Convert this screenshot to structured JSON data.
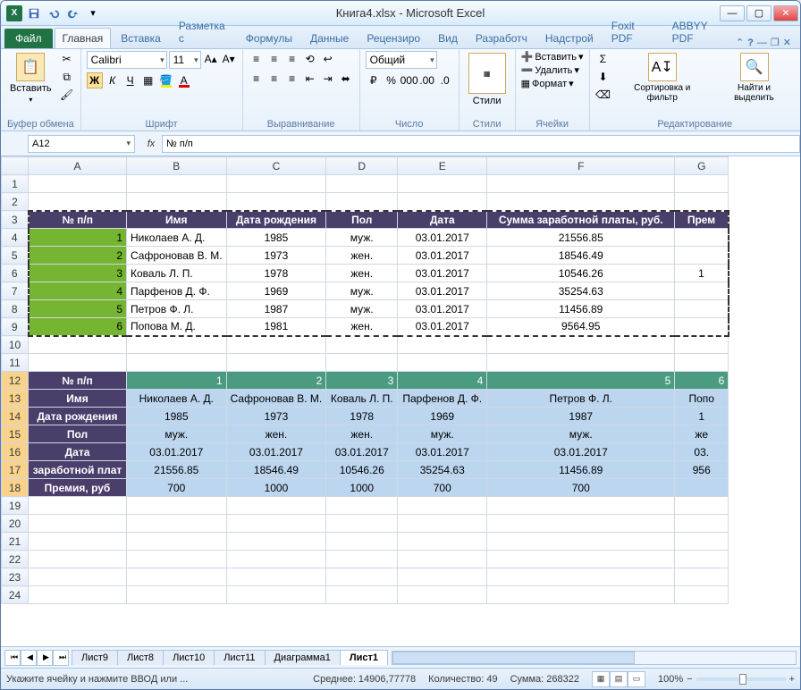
{
  "title": "Книга4.xlsx - Microsoft Excel",
  "ribbon_tabs": {
    "file": "Файл",
    "home": "Главная",
    "insert": "Вставка",
    "layout": "Разметка с",
    "formulas": "Формулы",
    "data": "Данные",
    "review": "Рецензиро",
    "view": "Вид",
    "developer": "Разработч",
    "addins": "Надстрой",
    "foxit": "Foxit PDF",
    "abbyy": "ABBYY PDF"
  },
  "groups": {
    "clipboard": "Буфер обмена",
    "font": "Шрифт",
    "alignment": "Выравнивание",
    "number": "Число",
    "styles": "Стили",
    "cells": "Ячейки",
    "editing": "Редактирование"
  },
  "paste_label": "Вставить",
  "font_name": "Calibri",
  "font_size": "11",
  "number_format": "Общий",
  "cells_menu": {
    "insert": "Вставить",
    "delete": "Удалить",
    "format": "Формат"
  },
  "editing": {
    "sort": "Сортировка и фильтр",
    "find": "Найти и выделить"
  },
  "namebox": "A12",
  "formula": "№ п/п",
  "cols": [
    "A",
    "B",
    "C",
    "D",
    "E",
    "F",
    "G"
  ],
  "t1": {
    "header": [
      "№ п/п",
      "Имя",
      "Дата рождения",
      "Пол",
      "Дата",
      "Сумма заработной платы, руб.",
      "Прем"
    ],
    "rows": [
      [
        "1",
        "Николаев А. Д.",
        "1985",
        "муж.",
        "03.01.2017",
        "21556.85",
        ""
      ],
      [
        "2",
        "Сафроновав В. М.",
        "1973",
        "жен.",
        "03.01.2017",
        "18546.49",
        ""
      ],
      [
        "3",
        "Коваль Л. П.",
        "1978",
        "жен.",
        "03.01.2017",
        "10546.26",
        "1"
      ],
      [
        "4",
        "Парфенов Д. Ф.",
        "1969",
        "муж.",
        "03.01.2017",
        "35254.63",
        ""
      ],
      [
        "5",
        "Петров Ф. Л.",
        "1987",
        "муж.",
        "03.01.2017",
        "11456.89",
        ""
      ],
      [
        "6",
        "Попова М. Д.",
        "1981",
        "жен.",
        "03.01.2017",
        "9564.95",
        ""
      ]
    ]
  },
  "t2": {
    "labels": [
      "№ п/п",
      "Имя",
      "Дата рождения",
      "Пол",
      "Дата",
      "заработной плат",
      "Премия, руб"
    ],
    "cols": [
      [
        "1",
        "Николаев А. Д.",
        "1985",
        "муж.",
        "03.01.2017",
        "21556.85",
        "700"
      ],
      [
        "2",
        "Сафроновав В. М.",
        "1973",
        "жен.",
        "03.01.2017",
        "18546.49",
        "1000"
      ],
      [
        "3",
        "Коваль Л. П.",
        "1978",
        "жен.",
        "03.01.2017",
        "10546.26",
        "1000"
      ],
      [
        "4",
        "Парфенов Д. Ф.",
        "1969",
        "муж.",
        "03.01.2017",
        "35254.63",
        "700"
      ],
      [
        "5",
        "Петров Ф. Л.",
        "1987",
        "муж.",
        "03.01.2017",
        "11456.89",
        "700"
      ],
      [
        "6",
        "Попо",
        "1",
        "же",
        "03.",
        "956",
        ""
      ]
    ]
  },
  "sheet_tabs": [
    "Лист9",
    "Лист8",
    "Лист10",
    "Лист11",
    "Диаграмма1",
    "Лист1"
  ],
  "active_sheet": "Лист1",
  "status": {
    "hint": "Укажите ячейку и нажмите ВВОД или ...",
    "avg": "Среднее: 14906,77778",
    "count": "Количество: 49",
    "sum": "Сумма: 268322",
    "zoom": "100%"
  },
  "chart_data": {
    "type": "table",
    "title": "Employee salary data (source and transposed view)",
    "columns": [
      "№ п/п",
      "Имя",
      "Дата рождения",
      "Пол",
      "Дата",
      "Сумма заработной платы, руб.",
      "Премия, руб"
    ],
    "rows": [
      [
        1,
        "Николаев А. Д.",
        1985,
        "муж.",
        "03.01.2017",
        21556.85,
        700
      ],
      [
        2,
        "Сафроновав В. М.",
        1973,
        "жен.",
        "03.01.2017",
        18546.49,
        1000
      ],
      [
        3,
        "Коваль Л. П.",
        1978,
        "жен.",
        "03.01.2017",
        10546.26,
        1000
      ],
      [
        4,
        "Парфенов Д. Ф.",
        1969,
        "муж.",
        "03.01.2017",
        35254.63,
        700
      ],
      [
        5,
        "Петров Ф. Л.",
        1987,
        "муж.",
        "03.01.2017",
        11456.89,
        700
      ],
      [
        6,
        "Попова М. Д.",
        1981,
        "жен.",
        "03.01.2017",
        9564.95,
        null
      ]
    ]
  }
}
